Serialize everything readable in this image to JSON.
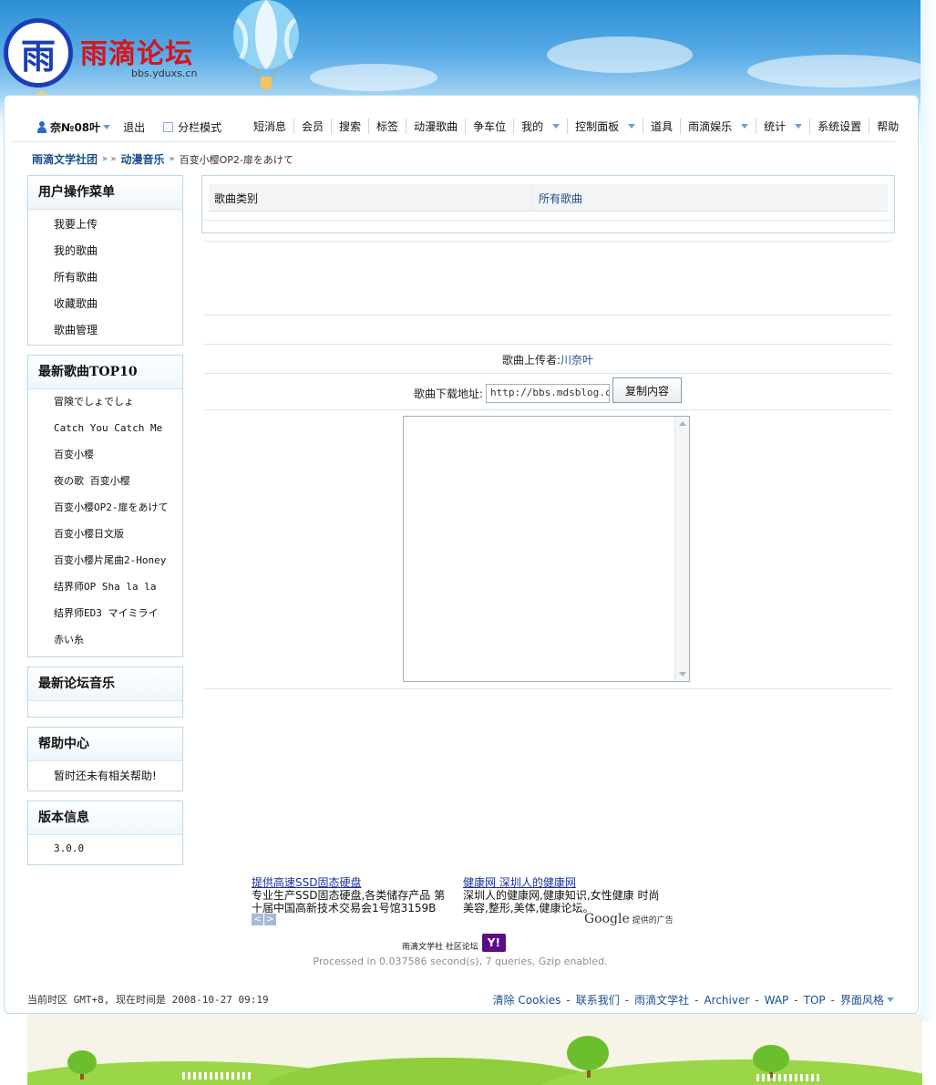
{
  "header": {
    "logo_glyph": "雨",
    "logo_text": "雨滴论坛",
    "logo_url": "bbs.yduxs.cn"
  },
  "topbar": {
    "username": "奈№08叶",
    "logout": "退出",
    "split_mode": "分栏模式",
    "nav": [
      {
        "label": "短消息",
        "dropdown": false
      },
      {
        "label": "会员",
        "dropdown": false
      },
      {
        "label": "搜索",
        "dropdown": false
      },
      {
        "label": "标签",
        "dropdown": false
      },
      {
        "label": "动漫歌曲",
        "dropdown": false
      },
      {
        "label": "争车位",
        "dropdown": false
      },
      {
        "label": "我的",
        "dropdown": true
      },
      {
        "label": "控制面板",
        "dropdown": true
      },
      {
        "label": "道具",
        "dropdown": false
      },
      {
        "label": "雨滴娱乐",
        "dropdown": true
      },
      {
        "label": "统计",
        "dropdown": true
      },
      {
        "label": "系统设置",
        "dropdown": false
      },
      {
        "label": "帮助",
        "dropdown": false
      }
    ]
  },
  "breadcrumb": {
    "home": "雨滴文学社团",
    "section": "动漫音乐",
    "current": "百变小樱OP2-扉をあけて",
    "sep": "»"
  },
  "sidebar": {
    "user_menu": {
      "title": "用户操作菜单",
      "items": [
        "我要上传",
        "我的歌曲",
        "所有歌曲",
        "收藏歌曲",
        "歌曲管理"
      ]
    },
    "top10": {
      "title": "最新歌曲TOP10",
      "items": [
        "冒険でしょでしょ",
        "Catch You Catch Me",
        "百变小樱",
        "夜の歌 百变小樱",
        "百变小樱OP2-扉をあけて",
        "百变小樱日文版",
        "百变小樱片尾曲2-Honey",
        "结界师OP Sha la la",
        "结界师ED3 マイミライ",
        "赤い糸"
      ]
    },
    "forum_music": {
      "title": "最新论坛音乐"
    },
    "help": {
      "title": "帮助中心",
      "body": "暂时还未有相关帮助!"
    },
    "version": {
      "title": "版本信息",
      "body": "3.0.0"
    }
  },
  "content": {
    "category_label": "歌曲类别",
    "category_value": "所有歌曲",
    "uploader_label": "歌曲上传者:",
    "uploader_name": "川奈叶",
    "download_label": "歌曲下载地址:",
    "download_value": "http://bbs.mdsblog.cn/",
    "copy_button": "复制内容"
  },
  "ads": [
    {
      "title": "提供高速SSD固态硬盘",
      "body": "专业生产SSD固态硬盘,各类储存产品 第十届中国高新技术交易会1号馆3159B"
    },
    {
      "title": "健康网 深圳人的健康网",
      "body": "深圳人的健康网,健康知识,女性健康 时尚美容,整形,美体,健康论坛。"
    }
  ],
  "google": {
    "word": "Google",
    "sub": "提供的广告"
  },
  "powered": {
    "text": "雨滴文学社 社区论坛",
    "badge": "Y!"
  },
  "processed": "Processed in 0.037586 second(s), 7 queries, Gzip enabled.",
  "footer": {
    "timezone": "当前时区 GMT+8, 现在时间是 2008-10-27 09:19",
    "links": [
      "清除 Cookies",
      "联系我们",
      "雨滴文学社",
      "Archiver",
      "WAP",
      "TOP",
      "界面风格"
    ],
    "sep": "-"
  },
  "colors": {
    "link": "#1a4f8f",
    "logo_red": "#d8141c",
    "logo_blue": "#1b3eb6",
    "sky": "#2d8fd6"
  }
}
